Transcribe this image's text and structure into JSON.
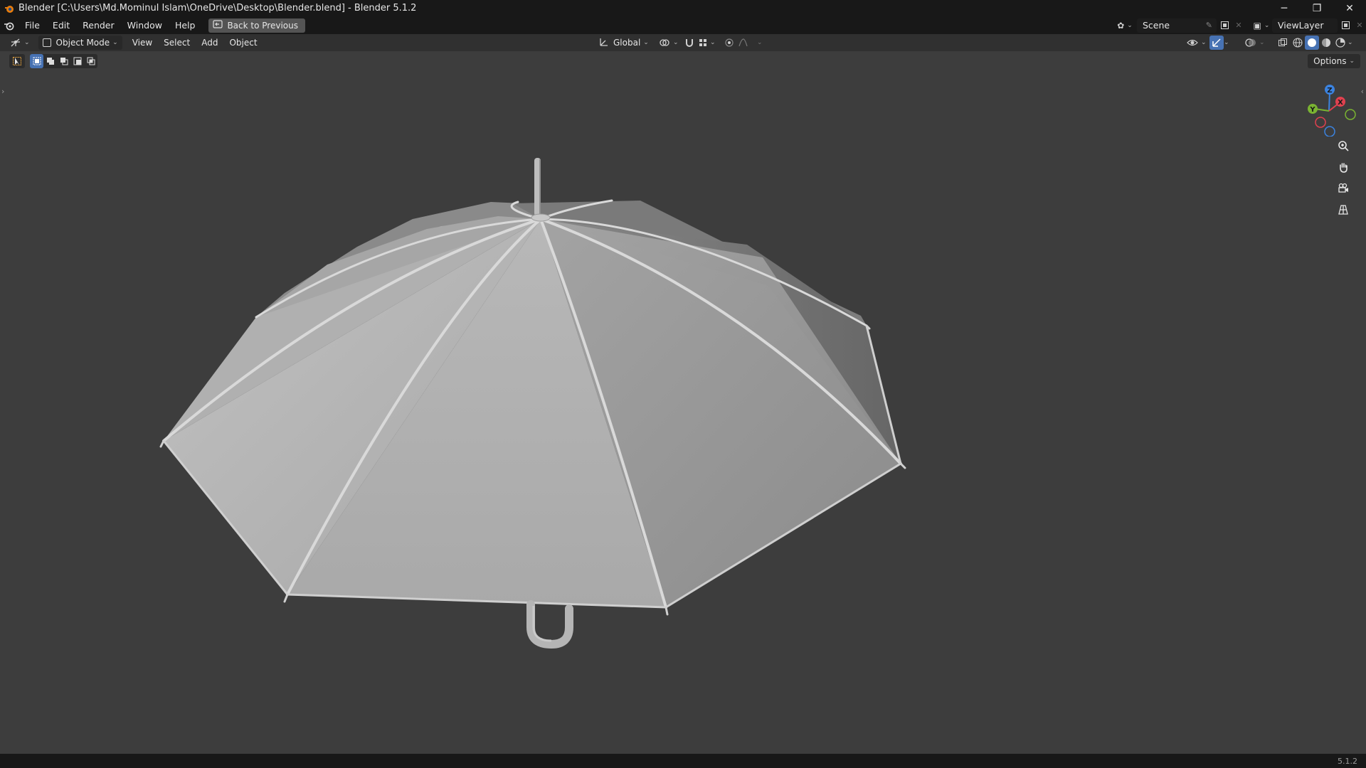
{
  "window": {
    "title": "Blender [C:\\Users\\Md.Mominul Islam\\OneDrive\\Desktop\\Blender.blend] - Blender 5.1.2",
    "controls": [
      "─",
      "❐",
      "✕"
    ]
  },
  "menu": {
    "items": [
      "File",
      "Edit",
      "Render",
      "Window",
      "Help"
    ],
    "back_button": "Back to Previous"
  },
  "scene": {
    "label": "Scene"
  },
  "view_layer": {
    "label": "ViewLayer"
  },
  "viewport_header": {
    "mode": "Object Mode",
    "menus": [
      "View",
      "Select",
      "Add",
      "Object"
    ],
    "orientation": "Global"
  },
  "toolbar": {
    "options_label": "Options"
  },
  "gizmo": {
    "x_label": "X",
    "y_label": "Y",
    "z_label": "Z"
  },
  "statusbar": {
    "version": "5.1.2"
  },
  "colors": {
    "accent": "#4772b3",
    "viewport_bg": "#3d3d3d",
    "axis_x": "#e0414f",
    "axis_y": "#7ab332",
    "axis_z": "#3b83e0"
  }
}
